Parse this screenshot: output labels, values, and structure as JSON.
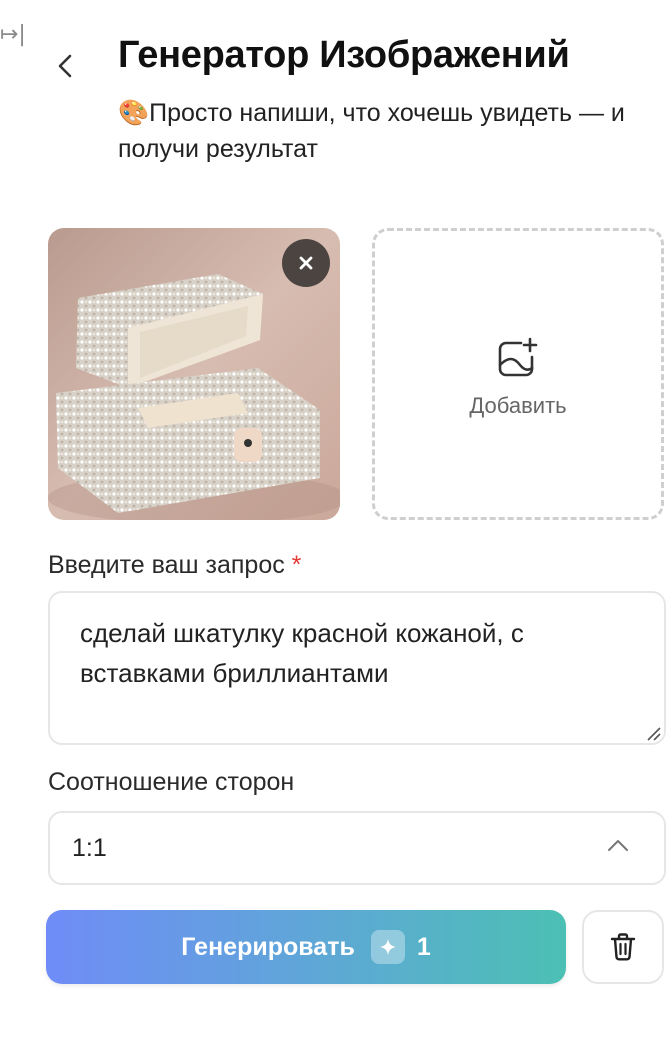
{
  "header": {
    "corner_glyph": "↦|",
    "title": "Генератор Изображений",
    "subtitle_emoji": "🎨",
    "subtitle": "Просто напиши, что хочешь увидеть — и получи результат",
    "back_icon": "chevron-left-icon"
  },
  "uploads": {
    "uploaded_image_icon": "jewelry-box-photo",
    "remove_icon": "close-icon",
    "add_icon": "add-image-icon",
    "add_label": "Добавить"
  },
  "prompt": {
    "label": "Введите ваш запрос",
    "required_mark": "*",
    "value": "сделай шкатулку красной кожаной, с вставками бриллиантами"
  },
  "aspect": {
    "label": "Соотношение сторон",
    "selected": "1:1",
    "chevron_icon": "chevron-up-icon"
  },
  "actions": {
    "generate_label": "Генерировать",
    "gem_icon": "diamond-icon",
    "cost": "1",
    "delete_icon": "trash-icon"
  },
  "colors": {
    "gradient_start": "#6f8cf7",
    "gradient_end": "#4cc0b4",
    "required": "#e53935"
  }
}
